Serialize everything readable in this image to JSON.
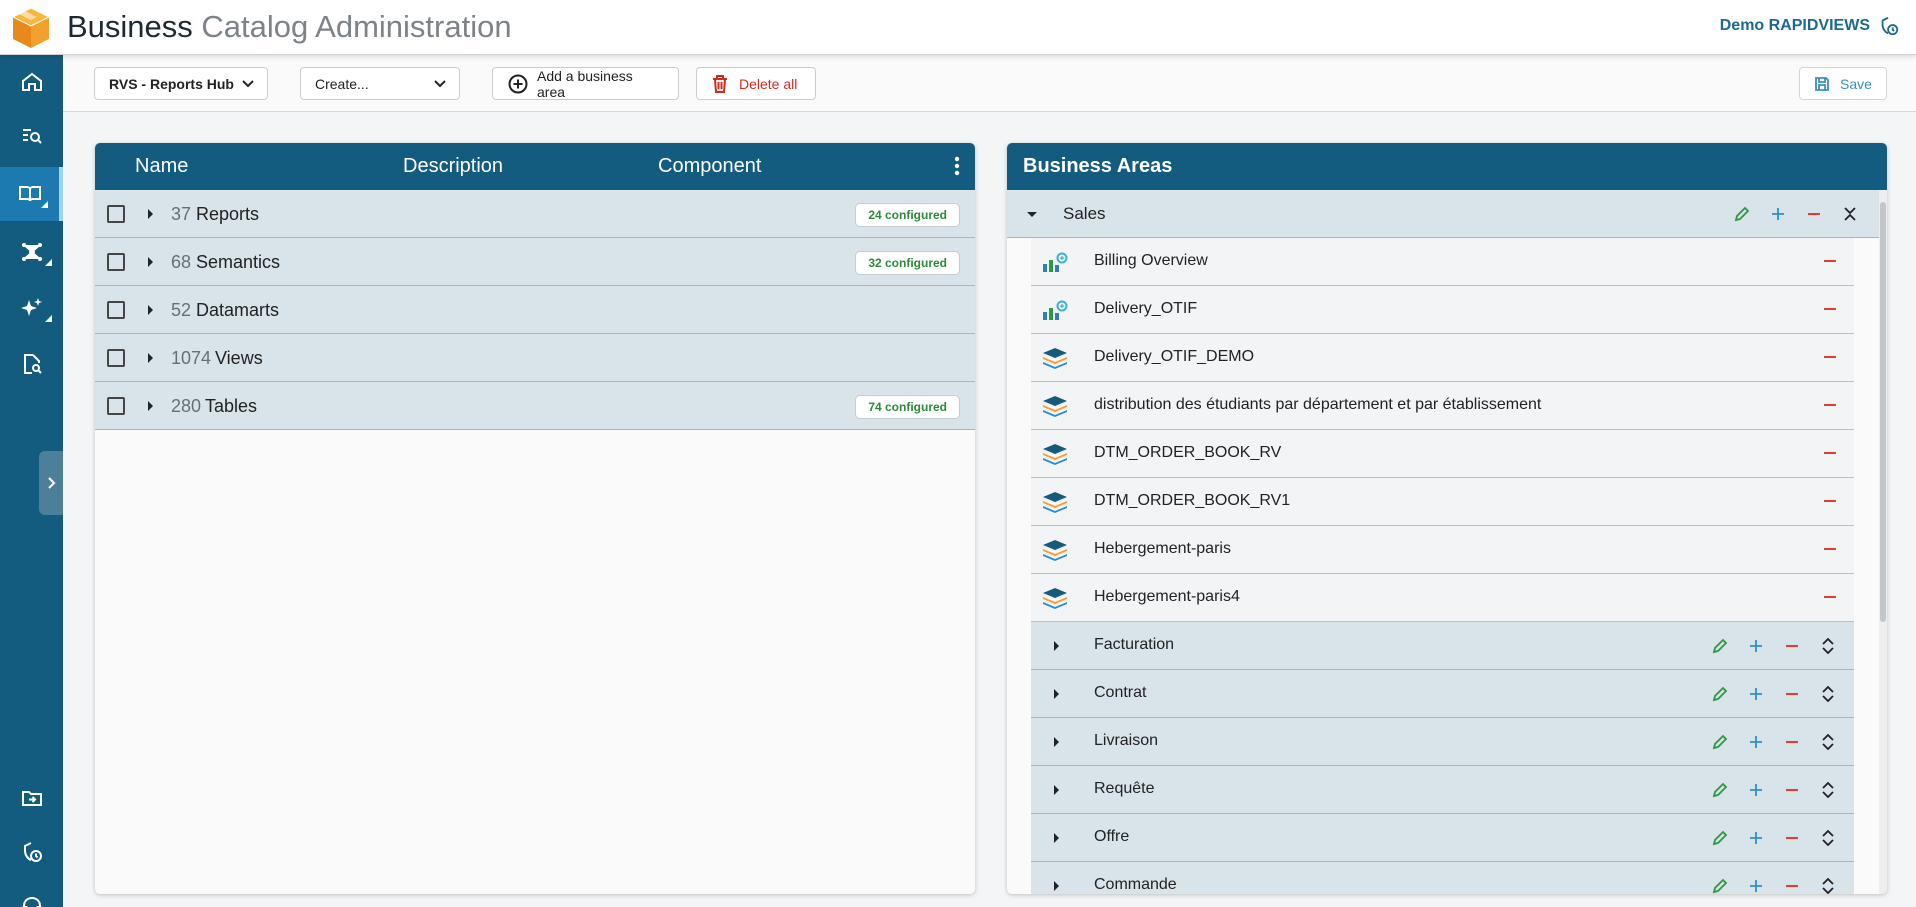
{
  "header": {
    "title_strong": "Business",
    "title_light": "Catalog Administration",
    "user": "Demo RAPIDVIEWS"
  },
  "toolbar": {
    "hub_select": "RVS - Reports Hub",
    "create_select": "Create...",
    "add_area": "Add a business area",
    "delete_all": "Delete all",
    "save": "Save"
  },
  "catalog": {
    "columns": [
      "Name",
      "Description",
      "Component"
    ],
    "rows": [
      {
        "count": "37",
        "label": "Reports",
        "badge": "24 configured"
      },
      {
        "count": "68",
        "label": "Semantics",
        "badge": "32 configured"
      },
      {
        "count": "52",
        "label": "Datamarts",
        "badge": ""
      },
      {
        "count": "1074",
        "label": "Views",
        "badge": ""
      },
      {
        "count": "280",
        "label": "Tables",
        "badge": "74 configured"
      }
    ]
  },
  "business_areas": {
    "title": "Business Areas",
    "root": "Sales",
    "items": [
      {
        "label": "Billing Overview",
        "icon": "report-chart-icon"
      },
      {
        "label": "Delivery_OTIF",
        "icon": "report-chart-icon"
      },
      {
        "label": "Delivery_OTIF_DEMO",
        "icon": "layers-stack-icon"
      },
      {
        "label": "distribution des étudiants par département et par établissement",
        "icon": "layers-stack-icon"
      },
      {
        "label": "DTM_ORDER_BOOK_RV",
        "icon": "layers-stack-icon"
      },
      {
        "label": "DTM_ORDER_BOOK_RV1",
        "icon": "layers-stack-icon"
      },
      {
        "label": "Hebergement-paris",
        "icon": "layers-stack-icon"
      },
      {
        "label": "Hebergement-paris4",
        "icon": "layers-stack-icon"
      }
    ],
    "sub_areas": [
      "Facturation",
      "Contrat",
      "Livraison",
      "Requête",
      "Offre",
      "Commande"
    ]
  },
  "colors": {
    "primary": "#135b7f",
    "active_nav": "#1c7ab0",
    "row_bg": "#d8e3ea",
    "edit": "#2c9a3c",
    "add": "#2a8fd0",
    "remove": "#e53b32",
    "badge_text": "#2c8a3a"
  }
}
